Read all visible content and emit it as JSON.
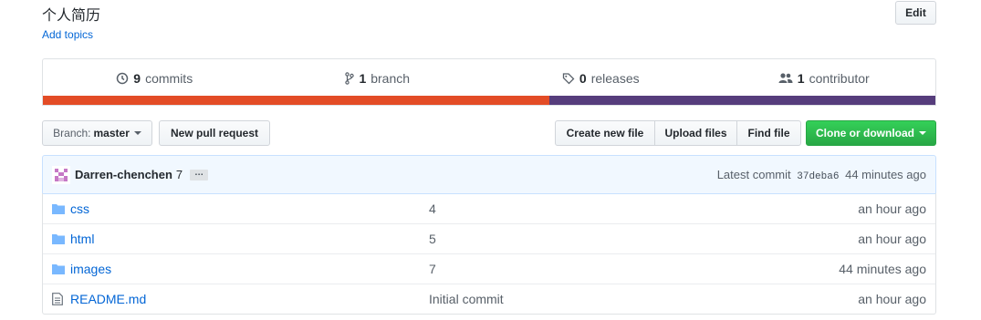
{
  "repo": {
    "description": "个人简历",
    "add_topics": "Add topics",
    "edit_label": "Edit"
  },
  "summary": {
    "commits_count": "9",
    "commits_label": "commits",
    "branch_count": "1",
    "branch_label": "branch",
    "releases_count": "0",
    "releases_label": "releases",
    "contributor_count": "1",
    "contributor_label": "contributor"
  },
  "languages": [
    {
      "color": "#e34c26",
      "share": 0.567
    },
    {
      "color": "#563d7c",
      "share": 0.433
    }
  ],
  "toolbar": {
    "branch_prefix": "Branch:",
    "branch_name": "master",
    "new_pr": "New pull request",
    "create_file": "Create new file",
    "upload_files": "Upload files",
    "find_file": "Find file",
    "clone": "Clone or download"
  },
  "latest_commit": {
    "author": "Darren-chenchen",
    "message": "7",
    "ellipsis": "…",
    "prefix": "Latest commit",
    "sha": "37deba6",
    "age": "44 minutes ago"
  },
  "files": [
    {
      "icon": "folder-icon",
      "name": "css",
      "message": "4",
      "age": "an hour ago"
    },
    {
      "icon": "folder-icon",
      "name": "html",
      "message": "5",
      "age": "an hour ago"
    },
    {
      "icon": "folder-icon",
      "name": "images",
      "message": "7",
      "age": "44 minutes ago"
    },
    {
      "icon": "file-icon",
      "name": "README.md",
      "message": "Initial commit",
      "age": "an hour ago"
    }
  ]
}
